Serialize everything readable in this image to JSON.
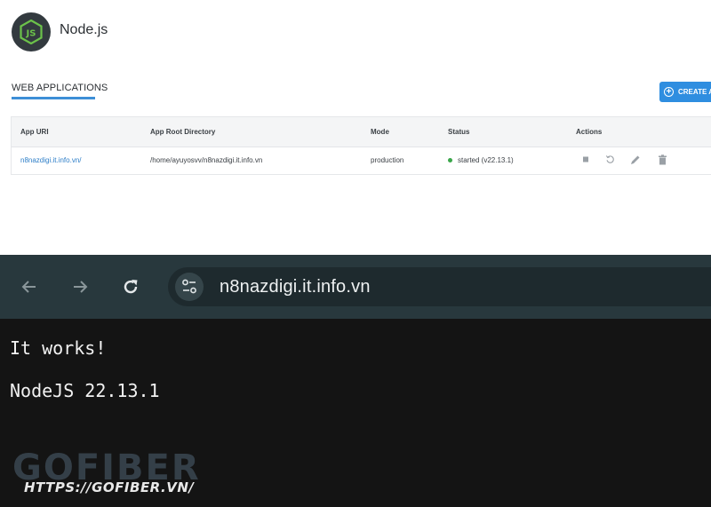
{
  "header": {
    "app_name": "Node.js",
    "icon": "nodejs-logo-icon"
  },
  "section": {
    "tab_label": "WEB APPLICATIONS",
    "create_button_label": "CREATE A"
  },
  "table": {
    "columns": [
      "App URI",
      "App Root Directory",
      "Mode",
      "Status",
      "Actions"
    ],
    "rows": [
      {
        "app_uri": "n8nazdigi.it.info.vn/",
        "root_dir": "/home/ayuyosvv/n8nazdigi.it.info.vn",
        "mode": "production",
        "status": "started (v22.13.1)",
        "status_color": "#3aa64a",
        "actions": [
          "stop-icon",
          "restart-icon",
          "edit-icon",
          "delete-icon"
        ]
      }
    ]
  },
  "browser": {
    "url": "n8nazdigi.it.info.vn",
    "icons": [
      "back-arrow-icon",
      "forward-arrow-icon",
      "reload-icon",
      "site-settings-icon"
    ]
  },
  "page": {
    "line1": "It works!",
    "line2": "NodeJS 22.13.1"
  },
  "watermark": {
    "brand": "GOFIBER",
    "url": "HTTPS://GOFIBER.VN/"
  },
  "colors": {
    "accent": "#2f8ee0",
    "link": "#2f7fc8",
    "browser_bar": "#28383d",
    "page_bg": "#141414"
  }
}
